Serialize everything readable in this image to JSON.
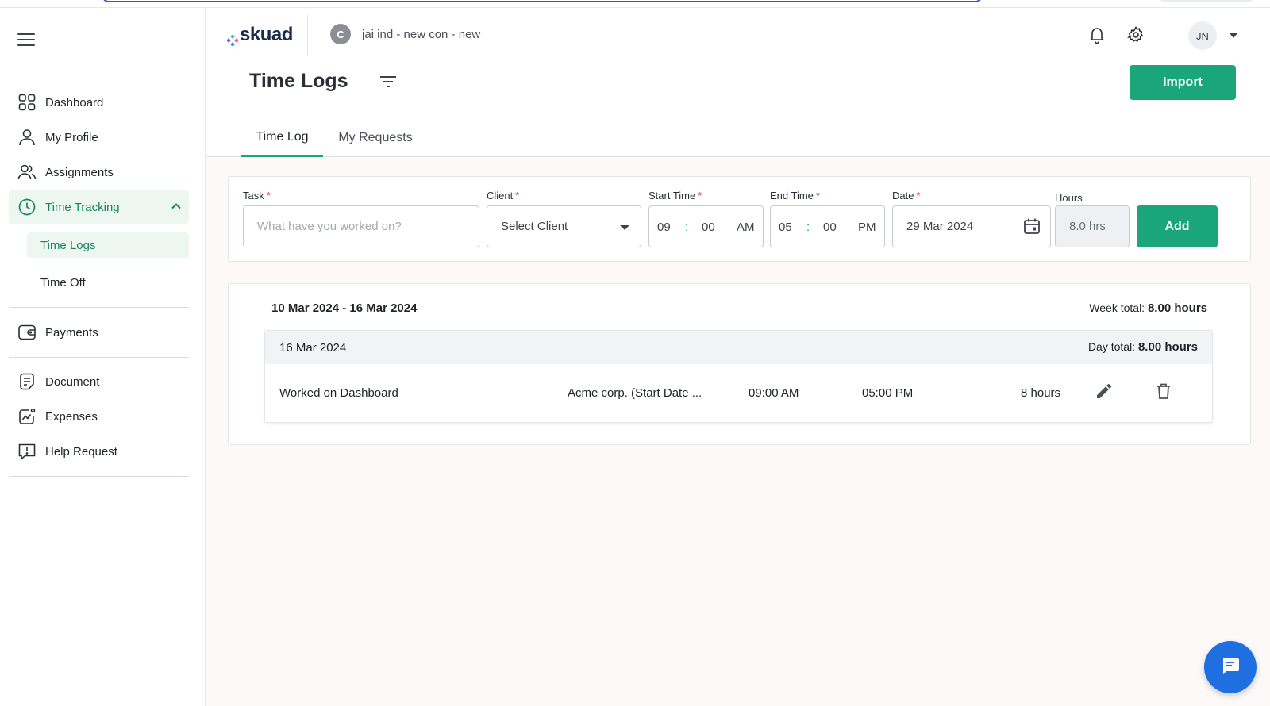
{
  "sidebar": {
    "items": [
      {
        "label": "Dashboard"
      },
      {
        "label": "My Profile"
      },
      {
        "label": "Assignments"
      },
      {
        "label": "Time Tracking"
      },
      {
        "label": "Payments"
      },
      {
        "label": "Document"
      },
      {
        "label": "Expenses"
      },
      {
        "label": "Help Request"
      }
    ],
    "sub_items": [
      {
        "label": "Time Logs"
      },
      {
        "label": "Time Off"
      }
    ]
  },
  "header": {
    "logo_text": "skuad",
    "company_initial": "C",
    "company_name": "jai ind - new con - new",
    "user_initials": "JN"
  },
  "page": {
    "title": "Time Logs",
    "import_label": "Import"
  },
  "tabs": [
    {
      "label": "Time Log"
    },
    {
      "label": "My Requests"
    }
  ],
  "form": {
    "task_label": "Task",
    "task_placeholder": "What have you worked on?",
    "client_label": "Client",
    "client_value": "Select Client",
    "start_label": "Start Time",
    "start_hour": "09",
    "start_min": "00",
    "start_ampm": "AM",
    "end_label": "End Time",
    "end_hour": "05",
    "end_min": "00",
    "end_ampm": "PM",
    "date_label": "Date",
    "date_value": "29 Mar 2024",
    "hours_label": "Hours",
    "hours_value": "8.0 hrs",
    "add_label": "Add",
    "required_mark": "*",
    "colon": ":"
  },
  "week": {
    "range": "10 Mar 2024 - 16 Mar 2024",
    "total_label": "Week total:",
    "total_value": "8.00 hours",
    "days": [
      {
        "date": "16 Mar 2024",
        "total_label": "Day total:",
        "total_value": "8.00 hours",
        "entries": [
          {
            "task": "Worked on Dashboard",
            "client": "Acme corp. (Start Date ...",
            "start": "09:00 AM",
            "end": "05:00 PM",
            "hours": "8 hours"
          }
        ]
      }
    ]
  },
  "colors": {
    "accent": "#1ba67a",
    "active_nav": "#13875f",
    "required": "#e5322d",
    "chat_fab": "#1f6fe0"
  },
  "icons": {
    "dashboard": "grid-icon",
    "profile": "person-icon",
    "assignments": "people-icon",
    "time_tracking": "clock-icon",
    "payments": "wallet-icon",
    "document": "document-icon",
    "expenses": "chart-icon",
    "help": "help-icon",
    "edit": "pencil-icon",
    "delete": "trash-icon",
    "chat": "chat-icon"
  }
}
